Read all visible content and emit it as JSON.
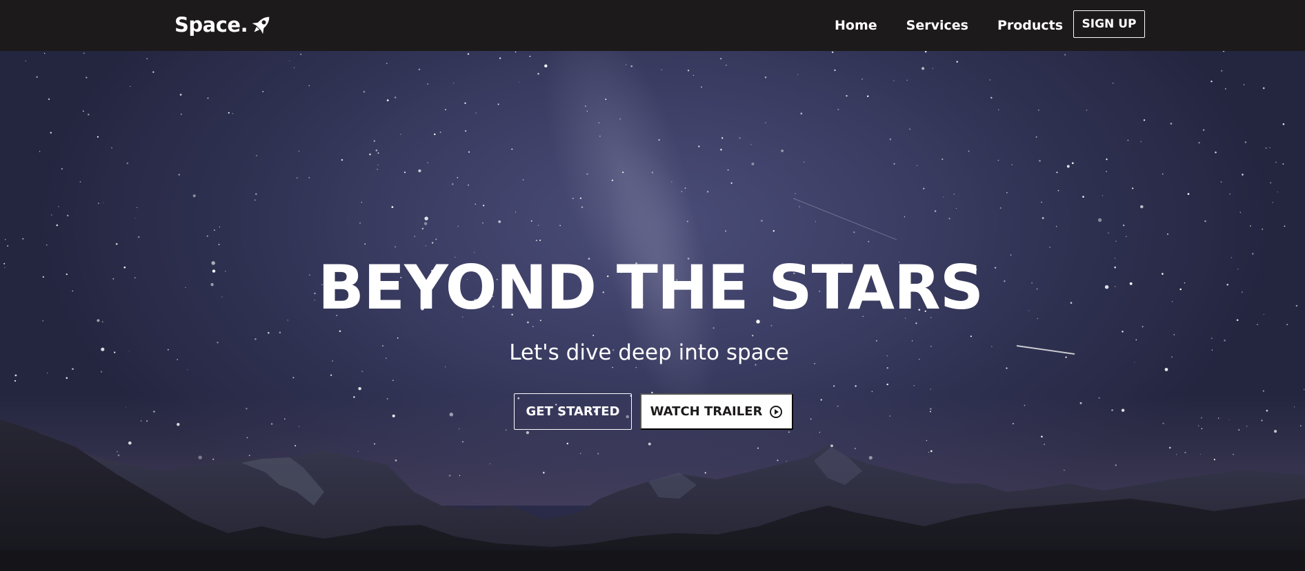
{
  "brand": {
    "name": "Space.",
    "logo_icon": "rocket-icon"
  },
  "nav": {
    "links": [
      {
        "label": "Home"
      },
      {
        "label": "Services"
      },
      {
        "label": "Products"
      }
    ],
    "signup_label": "SIGN UP"
  },
  "hero": {
    "title": "BEYOND THE STARS",
    "subtitle": "Let's dive deep into space",
    "primary_button": "GET STARTED",
    "secondary_button": "WATCH TRAILER",
    "secondary_icon": "play-circle-icon"
  },
  "colors": {
    "navbar_bg": "#1c1a1a",
    "sky_top": "#2e3050",
    "sky_center": "#4a4d78",
    "mountains": "#1f1f2e",
    "text": "#ffffff"
  }
}
